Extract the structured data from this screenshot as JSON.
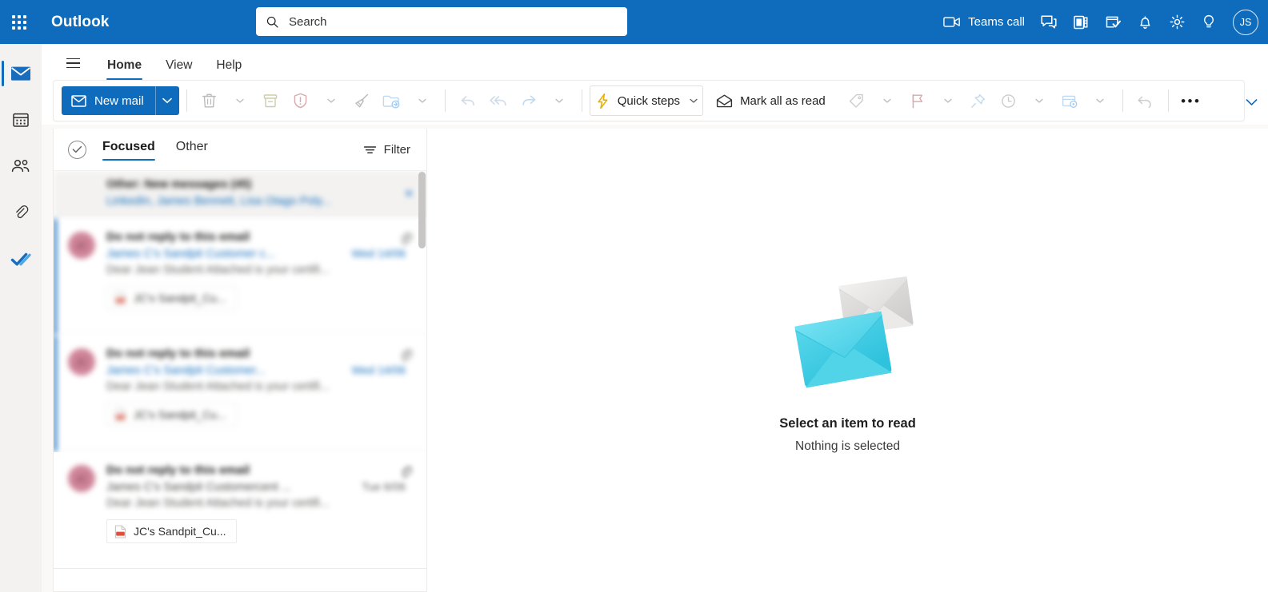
{
  "topbar": {
    "app_title": "Outlook",
    "waffle_label": "app-launcher",
    "search": {
      "placeholder": "Search",
      "value": ""
    },
    "teams_call_label": "Teams call",
    "icons": [
      "teams-call-icon",
      "chat-icon",
      "onenote-feed-icon",
      "to-do-icon",
      "notifications-icon",
      "settings-icon",
      "tips-icon"
    ],
    "avatar_initials": "JS",
    "background_color": "#0f6cbd"
  },
  "rail": {
    "items": [
      {
        "name": "mail",
        "icon": "mail-icon",
        "selected": true
      },
      {
        "name": "calendar",
        "icon": "calendar-icon",
        "selected": false
      },
      {
        "name": "people",
        "icon": "people-icon",
        "selected": false
      },
      {
        "name": "files",
        "icon": "paperclip-icon",
        "selected": false
      },
      {
        "name": "to-do",
        "icon": "checkmark-icon",
        "selected": false
      }
    ]
  },
  "ribbon": {
    "tabs": [
      {
        "label": "Home",
        "active": true
      },
      {
        "label": "View",
        "active": false
      },
      {
        "label": "Help",
        "active": false
      }
    ],
    "new_mail_label": "New mail",
    "quick_steps_label": "Quick steps",
    "mark_all_read_label": "Mark all as read",
    "commands": [
      "delete-icon",
      "archive-icon",
      "report-icon",
      "sweep-icon",
      "move-to-icon",
      "undo-arrow-icon",
      "reply-all-icon",
      "forward-icon",
      "tag-icon",
      "flag-icon",
      "pin-icon",
      "snooze-icon",
      "rules-icon",
      "undo-icon",
      "more-options-icon"
    ],
    "more_label": "•••"
  },
  "list": {
    "select_all_label": "select-all",
    "pivots": [
      {
        "label": "Focused",
        "active": true
      },
      {
        "label": "Other",
        "active": false
      }
    ],
    "filter_label": "Filter",
    "other_banner": {
      "title": "Other: New messages (45)",
      "senders": "LinkedIn, James Bennett, Lisa Otago Poly...",
      "close_label": "✕"
    },
    "messages": [
      {
        "subject": "Do not reply to this email",
        "from": "James C's Sandpit Customer c...",
        "date": "Wed 14/06",
        "preview": "Dear Jean Student Attached is your certifi...",
        "attachment": "JC's Sandpit_Cu...",
        "unread": true,
        "blurred": true,
        "avatar_initials": "JC"
      },
      {
        "subject": "Do not reply to this email",
        "from": "James C's Sandpit Customer...",
        "date": "Wed 14/06",
        "preview": "Dear Jean Student Attached is your certifi...",
        "attachment": "JC's Sandpit_Cu...",
        "unread": true,
        "blurred": true,
        "avatar_initials": "JC"
      },
      {
        "subject": "Do not reply to this email",
        "from": "James C's Sandpit Customercent ...",
        "date": "Tue 6/06",
        "preview": "Dear Jean Student Attached is your certifi...",
        "attachment": "JC's Sandpit_Cu...",
        "unread": false,
        "blurred": false,
        "avatar_initials": "JC"
      }
    ]
  },
  "reading_pane": {
    "empty_title": "Select an item to read",
    "empty_subtitle": "Nothing is selected",
    "art": "two-envelopes-illustration",
    "envelope_front_color": "#4FD2E8",
    "envelope_back_color": "#DCDCDC"
  }
}
